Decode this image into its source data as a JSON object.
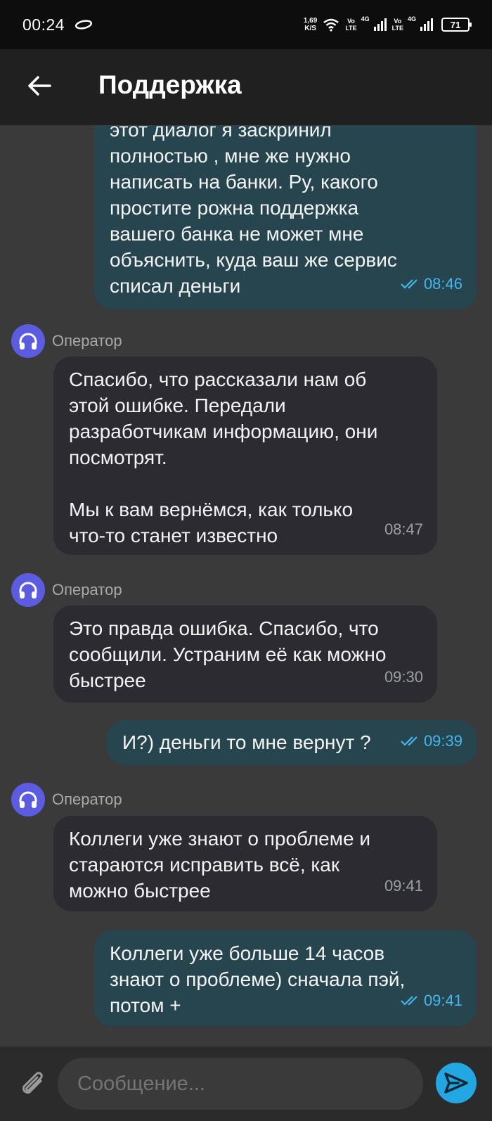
{
  "status_bar": {
    "time": "00:24",
    "net_speed_value": "1,69",
    "net_speed_unit": "K/S",
    "volte1_top": "Vo",
    "volte1_bottom": "LTE",
    "sig1_label": "4G",
    "volte2_top": "Vo",
    "volte2_bottom": "LTE",
    "sig2_label": "4G",
    "battery": "71"
  },
  "header": {
    "title": "Поддержка"
  },
  "messages": [
    {
      "type": "out",
      "text": "этот диалог я заскринил\nполностью , мне же нужно\nнаписать на банки. Ру, какого\nпростите рожна поддержка\nвашего банка не может мне\nобъяснить, куда ваш же сервис\nсписал деньги",
      "time": "08:46"
    },
    {
      "type": "in",
      "sender": "Оператор",
      "text": "Спасибо, что рассказали нам об\nэтой ошибке. Передали\nразработчикам информацию, они\nпосмотрят.\n\nМы к вам вернёмся, как только\nчто-то станет известно",
      "time": "08:47"
    },
    {
      "type": "in",
      "sender": "Оператор",
      "text": "Это правда ошибка. Спасибо, что\nсообщили. Устраним её как можно\nбыстрее",
      "time": "09:30"
    },
    {
      "type": "out",
      "text": "И?) деньги то мне вернут ?",
      "time": "09:39"
    },
    {
      "type": "in",
      "sender": "Оператор",
      "text": "Коллеги уже знают о проблеме и\nстараются исправить всё, как\nможно быстрее",
      "time": "09:41"
    },
    {
      "type": "out",
      "text": "Коллеги уже больше 14 часов\nзнают о проблеме) сначала пэй,\nпотом +",
      "time": "09:41"
    }
  ],
  "input": {
    "placeholder": "Сообщение..."
  },
  "colors": {
    "accent": "#23a7e2",
    "outgoing_bubble": "#26454f",
    "incoming_bubble": "#2b2b31",
    "avatar": "#5b5ce0",
    "read_check": "#43b7ee"
  },
  "icons": [
    "back-arrow-icon",
    "headphones-icon",
    "double-check-icon",
    "paperclip-icon",
    "send-icon"
  ]
}
